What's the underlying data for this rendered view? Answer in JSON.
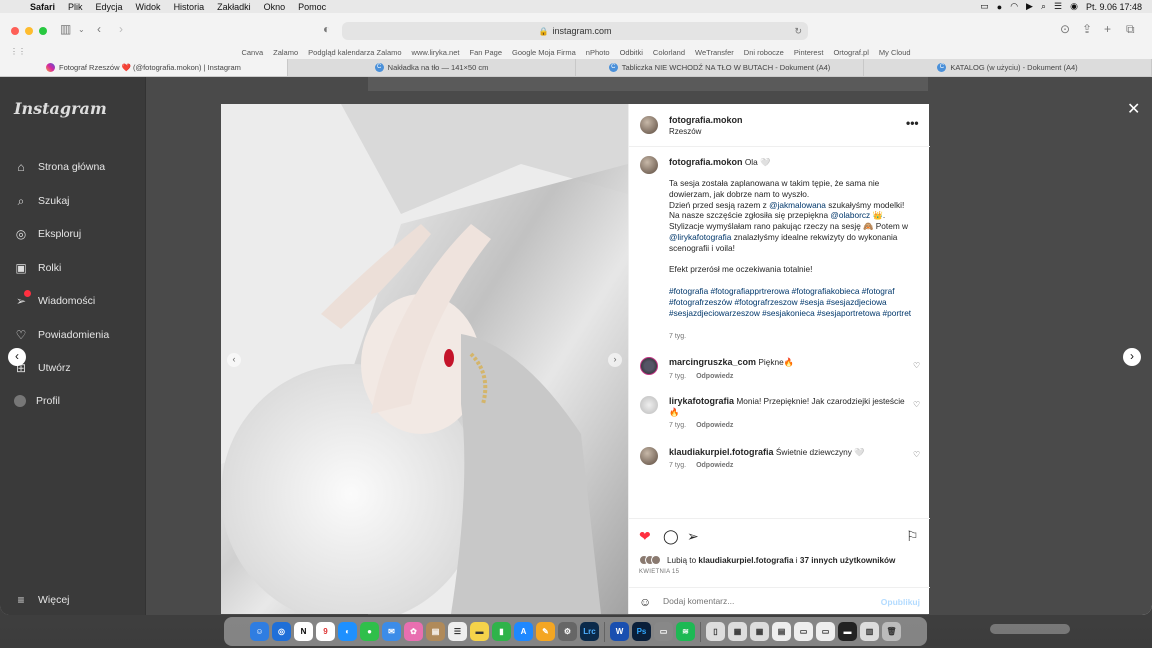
{
  "menubar": {
    "app": "Safari",
    "items": [
      "Plik",
      "Edycja",
      "Widok",
      "Historia",
      "Zakładki",
      "Okno",
      "Pomoc"
    ],
    "datetime": "Pt. 9.06  17:48"
  },
  "browser": {
    "url": "instagram.com",
    "favorites": [
      "Canva",
      "Zalamo",
      "Podgląd kalendarza Zalamo",
      "www.liryka.net",
      "Fan Page",
      "Google Moja Firma",
      "nPhoto",
      "Odbitki",
      "Colorland",
      "WeTransfer",
      "Dni robocze",
      "Pinterest",
      "Ortograf.pl",
      "My Cloud"
    ],
    "tabs": [
      {
        "label": "Fotograf Rzeszów ❤️ (@fotografia.mokon) | Instagram",
        "active": true
      },
      {
        "label": "Nakładka na tło — 141×50 cm",
        "active": false
      },
      {
        "label": "Tabliczka NIE WCHODŹ NA TŁO W BUTACH - Dokument (A4)",
        "active": false
      },
      {
        "label": "KATALOG (w użyciu) - Dokument (A4)",
        "active": false
      }
    ]
  },
  "sidebar": {
    "logo": "Instagram",
    "items": [
      {
        "label": "Strona główna",
        "icon": "home-icon"
      },
      {
        "label": "Szukaj",
        "icon": "search-icon"
      },
      {
        "label": "Eksploruj",
        "icon": "compass-icon"
      },
      {
        "label": "Rolki",
        "icon": "reels-icon"
      },
      {
        "label": "Wiadomości",
        "icon": "messages-icon"
      },
      {
        "label": "Powiadomienia",
        "icon": "heart-icon"
      },
      {
        "label": "Utwórz",
        "icon": "plus-icon"
      },
      {
        "label": "Profil",
        "icon": "avatar"
      }
    ],
    "more": "Więcej"
  },
  "post": {
    "author": "fotografia.mokon",
    "location": "Rzeszów",
    "caption_title": "Ola 🤍",
    "caption": {
      "p1a": "Ta sesja została zaplanowana w takim tępie, że sama nie dowierzam, jak dobrze nam to wyszło.",
      "p1b": "Dzień przed sesją razem z ",
      "mention1": "@jakmalowana",
      "p1c": " szukałyśmy modelki! Na nasze szczęście zgłosiła się przepiękna ",
      "mention2": "@olaborcz",
      "p1d": " 👑. Stylizacje wymyślałam rano pakując rzeczy na sesję 🙈 Potem w ",
      "mention3": "@lirykafotografia",
      "p1e": " znalazłyśmy idealne rekwizyty do wykonania scenografii i voila!",
      "p2": "Efekt przerósł me oczekiwania totalnie!",
      "hashtags": "#fotografia #fotografiapprtrerowa #fotografiakobieca #fotograf #fotografrzeszów #fotografrzeszow #sesja #sesjazdjeciowa #sesjazdjeciowarzeszow #sesjakonieca #sesjaportretowa #portret"
    },
    "caption_time": "7 tyg.",
    "comments": [
      {
        "user": "marcingruszka_com",
        "text": "Piękne🔥",
        "time": "7 tyg.",
        "reply": "Odpowiedz"
      },
      {
        "user": "lirykafotografia",
        "text": "Monia! Przepięknie! Jak czarodziejki jesteście 🔥",
        "time": "7 tyg.",
        "reply": "Odpowiedz"
      },
      {
        "user": "klaudiakurpiel.fotografia",
        "text": "Świetnie dziewczyny 🤍",
        "time": "7 tyg.",
        "reply": "Odpowiedz"
      }
    ],
    "likes": {
      "prefix": "Lubią to ",
      "user": "klaudiakurpiel.fotografia",
      "mid": " i ",
      "others": "37 innych użytkowników"
    },
    "date": "KWIETNIA 15",
    "comment_placeholder": "Dodaj komentarz...",
    "post_button": "Opublikuj"
  },
  "colors": {
    "accent_like": "#ff3040",
    "link": "#00376b",
    "post_disabled": "#b3dbff"
  }
}
